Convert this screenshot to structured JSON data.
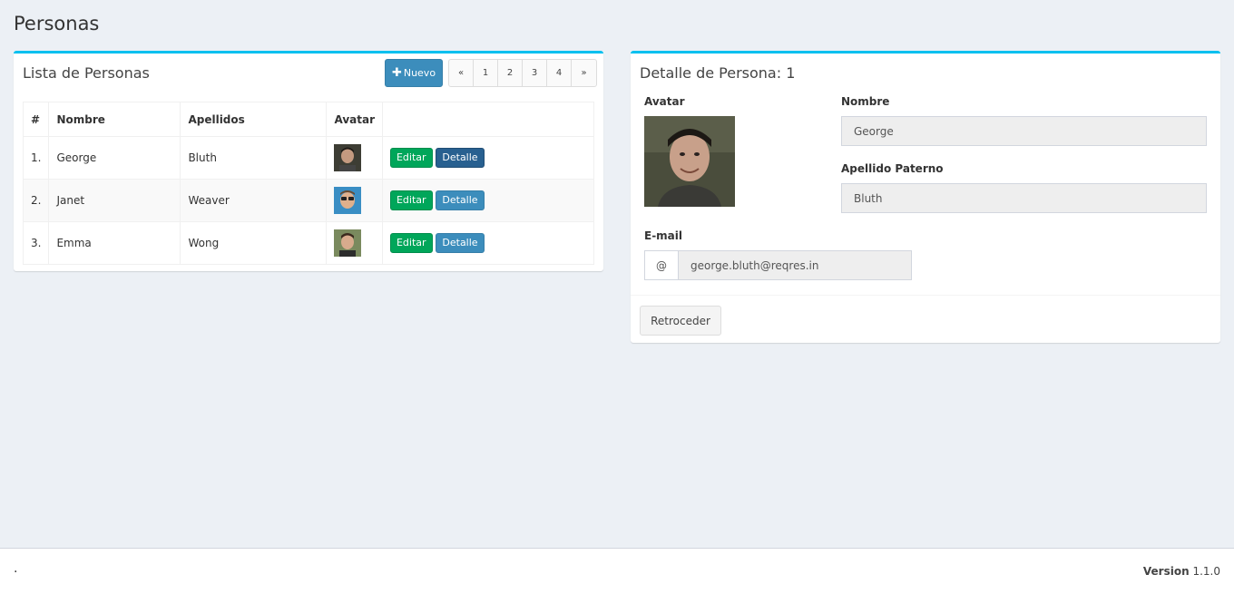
{
  "page": {
    "title": "Personas"
  },
  "list": {
    "title": "Lista de Personas",
    "new_button": "Nuevo",
    "pagination": [
      "«",
      "1",
      "2",
      "3",
      "4",
      "»"
    ],
    "columns": [
      "#",
      "Nombre",
      "Apellidos",
      "Avatar"
    ],
    "rows": [
      {
        "num": "1.",
        "nombre": "George",
        "apellidos": "Bluth",
        "edit": "Editar",
        "detail": "Detalle"
      },
      {
        "num": "2.",
        "nombre": "Janet",
        "apellidos": "Weaver",
        "edit": "Editar",
        "detail": "Detalle"
      },
      {
        "num": "3.",
        "nombre": "Emma",
        "apellidos": "Wong",
        "edit": "Editar",
        "detail": "Detalle"
      }
    ]
  },
  "detail": {
    "title": "Detalle de Persona: 1",
    "avatar_label": "Avatar",
    "nombre_label": "Nombre",
    "nombre_value": "George",
    "apellido_label": "Apellido Paterno",
    "apellido_value": "Bluth",
    "email_label": "E-mail",
    "email_addon": "@",
    "email_value": "george.bluth@reqres.in",
    "back_button": "Retroceder"
  },
  "footer": {
    "left": ".",
    "version_label": "Version",
    "version_value": "1.1.0"
  },
  "colors": {
    "accent": "#00c0ef",
    "primary": "#3c8dbc",
    "success": "#00a65a",
    "background": "#ecf0f5"
  }
}
